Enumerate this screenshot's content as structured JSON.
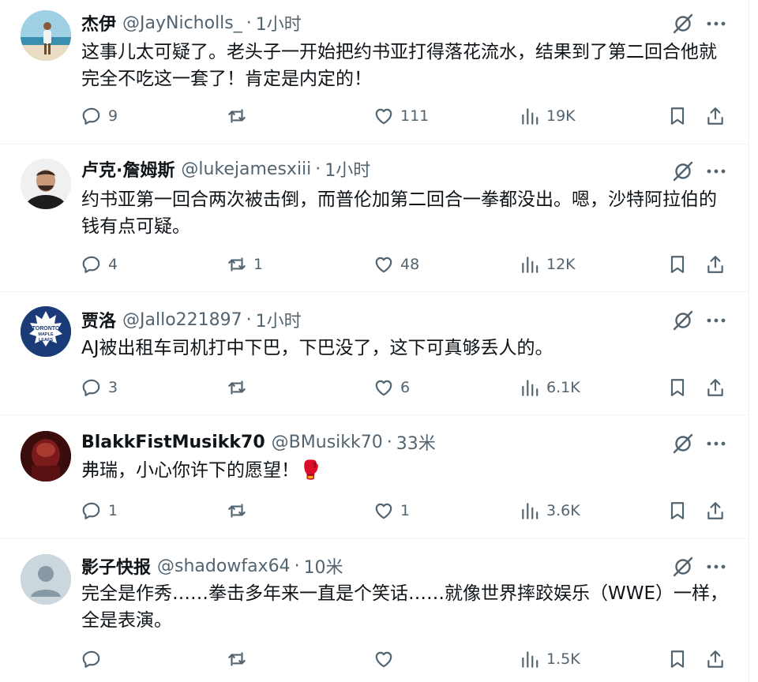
{
  "tweets": [
    {
      "display_name": "杰伊",
      "handle": "@JayNicholls_",
      "sep": "·",
      "time": "1小时",
      "text": "这事儿太可疑了。老头子一开始把约书亚打得落花流水，结果到了第二回合他就完全不吃这一套了！肯定是内定的！",
      "replies": "9",
      "retweets": "",
      "likes": "111",
      "views": "19K"
    },
    {
      "display_name": "卢克·詹姆斯",
      "handle": "@lukejamesxiii",
      "sep": "·",
      "time": "1小时",
      "text": "约书亚第一回合两次被击倒，而普伦加第二回合一拳都没出。嗯，沙特阿拉伯的钱有点可疑。",
      "replies": "4",
      "retweets": "1",
      "likes": "48",
      "views": "12K"
    },
    {
      "display_name": "贾洛",
      "handle": "@Jallo221897",
      "sep": "·",
      "time": "1小时",
      "text": "AJ被出租车司机打中下巴，下巴没了，这下可真够丢人的。",
      "replies": "3",
      "retweets": "",
      "likes": "6",
      "views": "6.1K",
      "avatar_text": "TORONTO MAPLE LEAFS"
    },
    {
      "display_name": "BlakkFistMusikk70",
      "handle": "@BMusikk70",
      "sep": "·",
      "time": "33米",
      "text": "弗瑞，小心你许下的愿望！🥊",
      "replies": "1",
      "retweets": "",
      "likes": "1",
      "views": "3.6K"
    },
    {
      "display_name": "影子快报",
      "handle": "@shadowfax64",
      "sep": "·",
      "time": "10米",
      "text": "完全是作秀……拳击多年来一直是个笑话……就像世界摔跤娱乐（WWE）一样，全是表演。",
      "replies": "",
      "retweets": "",
      "likes": "",
      "views": "1.5K"
    }
  ],
  "icons": {
    "reply": "reply-icon",
    "retweet": "retweet-icon",
    "like": "heart-icon",
    "views": "views-icon",
    "bookmark": "bookmark-icon",
    "share": "share-icon",
    "grok": "grok-icon",
    "more": "more-icon"
  },
  "colors": {
    "text": "#0f1419",
    "secondary": "#536471",
    "divider": "#eff3f4"
  }
}
